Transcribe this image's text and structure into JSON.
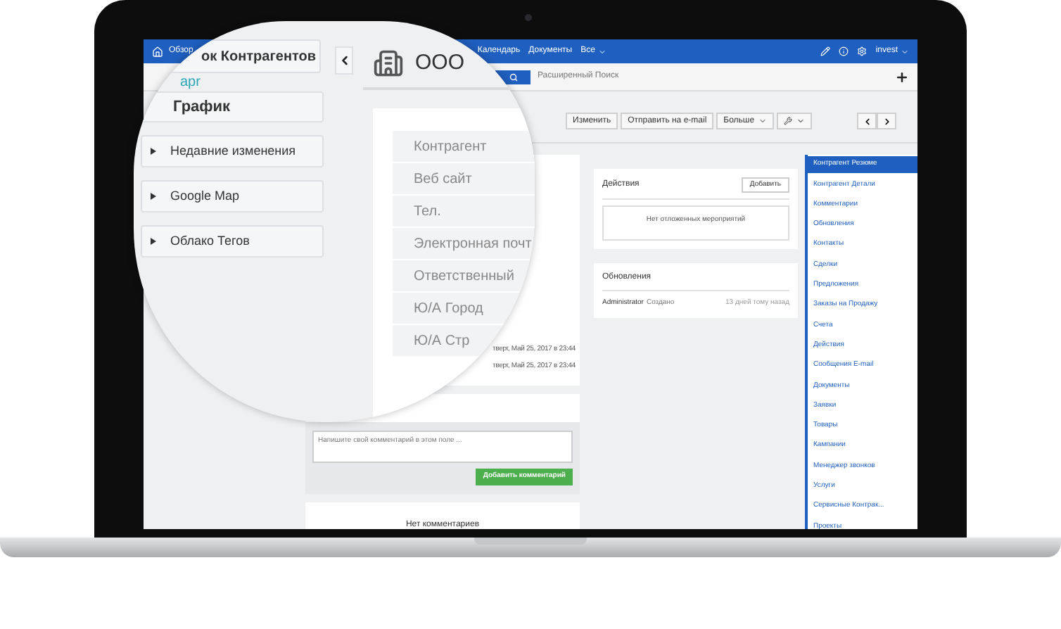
{
  "top_nav": {
    "home_link": "Обзор",
    "items": [
      "Календарь",
      "Документы",
      "Все"
    ],
    "user": "invest"
  },
  "search": {
    "advanced_link": "Расширенный Поиск"
  },
  "toolbar": {
    "buttons": [
      "Изменить",
      "Отправить на e-mail",
      "Больше"
    ]
  },
  "record_card": {
    "timestamps": [
      "тверг, Май 25, 2017 в 23:44",
      "тверг, Май 25, 2017 в 23:44"
    ]
  },
  "comments": {
    "placeholder": "Напишите свой комментарий в этом поле ...",
    "submit": "Добавить комментарий",
    "empty": "Нет комментариев"
  },
  "actions_panel": {
    "title": "Действия",
    "add_button": "Добавить",
    "empty": "Нет отложенных мероприятий"
  },
  "updates_panel": {
    "title": "Обновления",
    "entries": [
      {
        "user": "Administrator",
        "action": "Создано",
        "time": "13 дней тому назад"
      }
    ]
  },
  "related_nav": [
    {
      "label": "Контрагент Резюме",
      "selected": true
    },
    {
      "label": "Контрагент Детали",
      "selected": false
    },
    {
      "label": "Комментарии",
      "selected": false
    },
    {
      "label": "Обновления",
      "selected": false
    },
    {
      "label": "Контакты",
      "selected": false
    },
    {
      "label": "Сделки",
      "selected": false
    },
    {
      "label": "Предложения",
      "selected": false
    },
    {
      "label": "Заказы на Продажу",
      "selected": false
    },
    {
      "label": "Счета",
      "selected": false
    },
    {
      "label": "Действия",
      "selected": false
    },
    {
      "label": "Сообщения E-mail",
      "selected": false
    },
    {
      "label": "Документы",
      "selected": false
    },
    {
      "label": "Заявки",
      "selected": false
    },
    {
      "label": "Товары",
      "selected": false
    },
    {
      "label": "Кампании",
      "selected": false
    },
    {
      "label": "Менеджер звонков",
      "selected": false
    },
    {
      "label": "Услуги",
      "selected": false
    },
    {
      "label": "Сервисные Контрак...",
      "selected": false
    },
    {
      "label": "Проекты",
      "selected": false
    }
  ],
  "magnifier": {
    "title": "ок Контрагентов",
    "logo": "apr",
    "dashlets": [
      {
        "label": "График",
        "kind": "header"
      },
      {
        "label": "Недавние изменения",
        "kind": "collapsible"
      },
      {
        "label": "Google Map",
        "kind": "collapsible"
      },
      {
        "label": "Облако Тегов",
        "kind": "collapsible"
      }
    ],
    "record_title": "ООО",
    "fields": [
      "Контрагент",
      "Веб сайт",
      "Тел.",
      "Электронная почт",
      "Ответственный",
      "Ю/А Город",
      "Ю/А Стр"
    ]
  }
}
